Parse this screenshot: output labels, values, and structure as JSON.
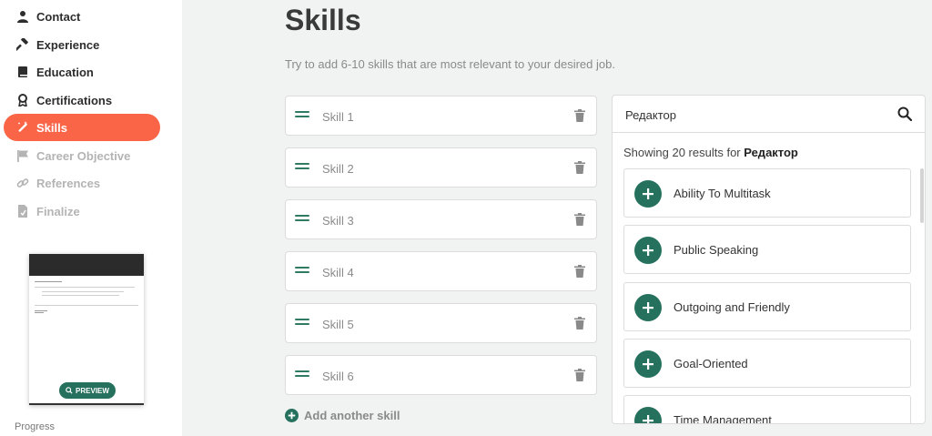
{
  "sidebar": {
    "items": [
      {
        "label": "Contact",
        "icon": "user-icon",
        "state": "normal"
      },
      {
        "label": "Experience",
        "icon": "hammer-icon",
        "state": "normal"
      },
      {
        "label": "Education",
        "icon": "book-icon",
        "state": "normal"
      },
      {
        "label": "Certifications",
        "icon": "award-icon",
        "state": "normal"
      },
      {
        "label": "Skills",
        "icon": "magic-wand-icon",
        "state": "active"
      },
      {
        "label": "Career Objective",
        "icon": "flag-icon",
        "state": "disabled"
      },
      {
        "label": "References",
        "icon": "link-icon",
        "state": "disabled"
      },
      {
        "label": "Finalize",
        "icon": "document-icon",
        "state": "disabled"
      }
    ],
    "preview_button": "PREVIEW",
    "progress_label": "Progress"
  },
  "main": {
    "title": "Skills",
    "subtitle": "Try to add 6-10 skills that are most relevant to your desired job.",
    "skills": [
      {
        "placeholder": "Skill 1",
        "value": ""
      },
      {
        "placeholder": "Skill 2",
        "value": ""
      },
      {
        "placeholder": "Skill 3",
        "value": ""
      },
      {
        "placeholder": "Skill 4",
        "value": ""
      },
      {
        "placeholder": "Skill 5",
        "value": ""
      },
      {
        "placeholder": "Skill 6",
        "value": ""
      }
    ],
    "add_skill_label": "Add another skill"
  },
  "search": {
    "query": "Редактор",
    "results_prefix": "Showing 20 results for ",
    "results_query": "Редактор",
    "results": [
      "Ability To Multitask",
      "Public Speaking",
      "Outgoing and Friendly",
      "Goal-Oriented",
      "Time Management"
    ]
  },
  "colors": {
    "accent": "#fa6447",
    "green": "#26715e",
    "disabled": "#b4b4b4"
  }
}
